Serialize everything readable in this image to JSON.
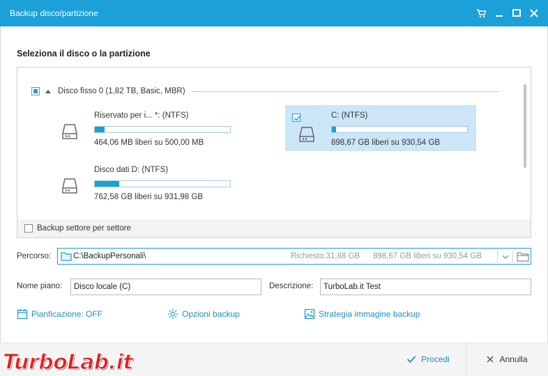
{
  "window": {
    "title": "Backup disco/partizione"
  },
  "section_title": "Seleziona il disco o la partizione",
  "disk": {
    "label": "Disco fisso 0 (1,82 TB, Basic, MBR)",
    "partitions": [
      {
        "name": "Riservato per i... *: (NTFS)",
        "info": "464,06 MB liberi su 500,00 MB",
        "used_percent": 7,
        "selected": false
      },
      {
        "name": "C: (NTFS)",
        "info": "898,67 GB liberi su 930,54 GB",
        "used_percent": 3,
        "selected": true
      },
      {
        "name": "Disco dati D: (NTFS)",
        "info": "762,58 GB liberi su 931,98 GB",
        "used_percent": 18,
        "selected": false
      }
    ]
  },
  "sector_backup_label": "Backup settore per settore",
  "path": {
    "label": "Percorso:",
    "value": "C:\\BackupPersonali\\",
    "required": "Richiesto:31,88 GB",
    "free": "898,67 GB liberi su 930,54 GB"
  },
  "plan": {
    "label": "Nome piano:",
    "value": "Disco locale (C)"
  },
  "description": {
    "label": "Descrizione:",
    "value": "TurboLab.it Test"
  },
  "links": {
    "schedule": "Pianficazione: OFF",
    "options": "Opzioni backup",
    "strategy": "Strategia immagine backup"
  },
  "buttons": {
    "proceed": "Procedi",
    "cancel": "Annulla"
  },
  "watermark": "TurboLab.it",
  "colors": {
    "accent": "#1ba0d8",
    "selection": "#cce6f8",
    "watermark": "#e02020"
  }
}
